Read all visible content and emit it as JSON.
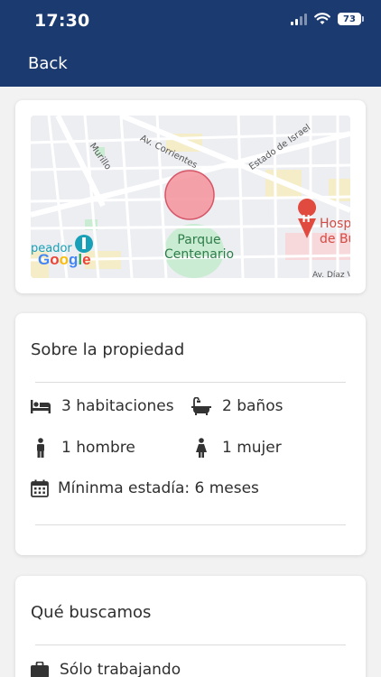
{
  "status_bar": {
    "time": "17:30",
    "battery": "73"
  },
  "nav": {
    "back_label": "Back"
  },
  "map": {
    "labels": {
      "street_corrientes": "Av. Corrientes",
      "street_murillo": "Murillo",
      "street_israel": "Estado de Israel",
      "street_diaz": "Av. Díaz V",
      "park": "Parque\nCentenario",
      "hospital": "Hosp\nde Bu",
      "station": "peador",
      "google": [
        "G",
        "o",
        "o",
        "g",
        "l",
        "e"
      ]
    }
  },
  "property": {
    "title": "Sobre la propiedad",
    "rooms": "3 habitaciones",
    "bathrooms": "2 baños",
    "men": "1 hombre",
    "women": "1 mujer",
    "min_stay": "Míninma estadía: 6 meses"
  },
  "wanted": {
    "title": "Qué buscamos",
    "working": "Sólo trabajando"
  }
}
